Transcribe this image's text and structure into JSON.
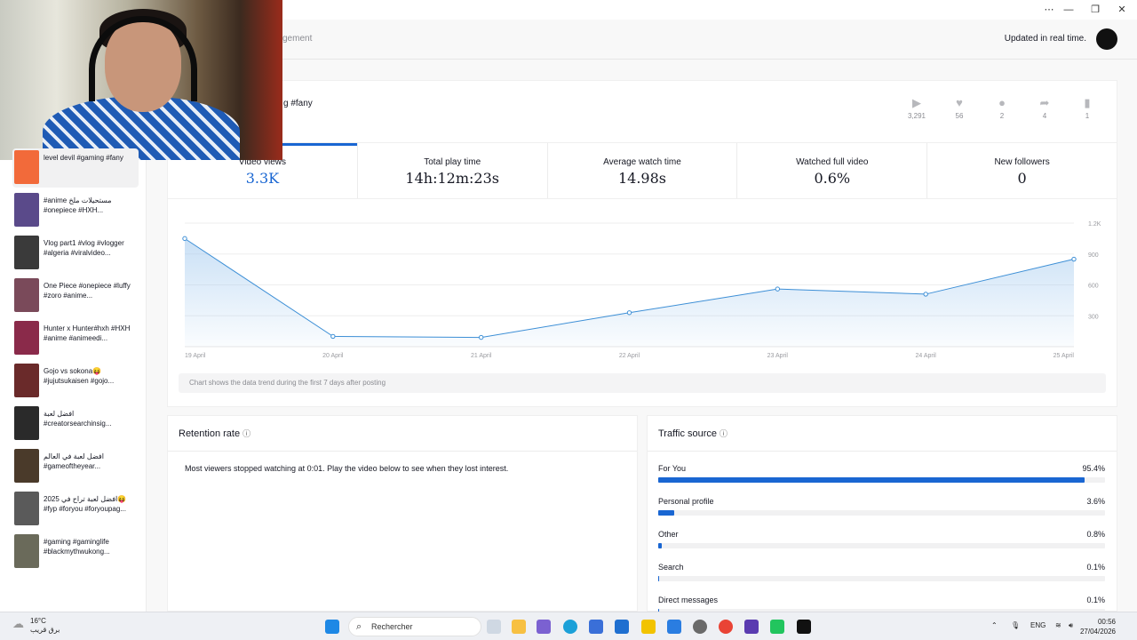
{
  "window": {
    "minimize_glyph": "—",
    "restore_glyph": "❐",
    "close_glyph": "✕",
    "inner_min_glyph": "⋯"
  },
  "header": {
    "breadcrumb_fragment": "gement",
    "updated_text": "Updated in real time."
  },
  "video": {
    "caption_fragment": "g #fany",
    "stats": [
      {
        "icon": "play-icon",
        "glyph": "▶",
        "value": "3,291"
      },
      {
        "icon": "heart-icon",
        "glyph": "♥",
        "value": "56"
      },
      {
        "icon": "comment-icon",
        "glyph": "●",
        "value": "2"
      },
      {
        "icon": "share-icon",
        "glyph": "➦",
        "value": "4"
      },
      {
        "icon": "bookmark-icon",
        "glyph": "▮",
        "value": "1"
      }
    ]
  },
  "metrics": [
    {
      "label": "Video views",
      "value": "3.3K",
      "active": true
    },
    {
      "label": "Total play time",
      "value": "14h:12m:23s",
      "active": false
    },
    {
      "label": "Average watch time",
      "value": "14.98s",
      "active": false
    },
    {
      "label": "Watched full video",
      "value": "0.6%",
      "active": false
    },
    {
      "label": "New followers",
      "value": "0",
      "active": false
    }
  ],
  "chart_data": {
    "type": "area",
    "title": "",
    "xlabel": "",
    "ylabel": "",
    "categories": [
      "19 April",
      "20 April",
      "21 April",
      "22 April",
      "23 April",
      "24 April",
      "25 April"
    ],
    "series": [
      {
        "values": [
          1050,
          100,
          90,
          330,
          560,
          510,
          850
        ]
      }
    ],
    "yticks": [
      "1.2K",
      "900",
      "600",
      "300"
    ],
    "ytick_values": [
      1200,
      900,
      600,
      300
    ],
    "ylim": [
      0,
      1200
    ],
    "grid": true,
    "color": "#3d8fd6",
    "note": "Chart shows the data trend during the first 7 days after posting"
  },
  "retention": {
    "title": "Retention rate",
    "text": "Most viewers stopped watching at 0:01. Play the video below to see when they lost interest."
  },
  "traffic": {
    "title": "Traffic source",
    "rows": [
      {
        "label": "For You",
        "pct_text": "95.4%",
        "pct": 95.4
      },
      {
        "label": "Personal profile",
        "pct_text": "3.6%",
        "pct": 3.6
      },
      {
        "label": "Other",
        "pct_text": "0.8%",
        "pct": 0.8
      },
      {
        "label": "Search",
        "pct_text": "0.1%",
        "pct": 0.1
      },
      {
        "label": "Direct messages",
        "pct_text": "0.1%",
        "pct": 0.1
      }
    ]
  },
  "sidebar": {
    "items": [
      {
        "title": "level devil #gaming #fany",
        "thumb": "#f26a3a",
        "active": true
      },
      {
        "title": "#anime مستحيلات ملخ #onepiece #HXH...",
        "thumb": "#5a4a8a",
        "active": false
      },
      {
        "title": "Vlog part1 #vlog #vlogger #algeria #viralvideo...",
        "thumb": "#3a3a3a",
        "active": false
      },
      {
        "title": "One Piece #onepiece #luffy #zoro #anime...",
        "thumb": "#7a4a5a",
        "active": false
      },
      {
        "title": "Hunter x Hunter#hxh #HXH #anime #animeedi...",
        "thumb": "#8a2a4a",
        "active": false
      },
      {
        "title": "Gojo vs sokona😝 #jujutsukaisen #gojo...",
        "thumb": "#6a2a2a",
        "active": false
      },
      {
        "title": "افضل لعبة #creatorsearchinsig...",
        "thumb": "#2a2a2a",
        "active": false
      },
      {
        "title": "افضل لعبة في العالم #gameoftheyear...",
        "thumb": "#4a3a2a",
        "active": false
      },
      {
        "title": "افضل لعبة تراح في 2025😝 #fyp #foryou #foryoupag...",
        "thumb": "#5a5a5a",
        "active": false
      },
      {
        "title": "#gaming #gaminglife #blackmythwukong...",
        "thumb": "#6a6a5a",
        "active": false
      }
    ]
  },
  "taskbar": {
    "weather_temp": "16°C",
    "weather_desc": "برق قريب",
    "search_text": "Rechercher",
    "lang": "ENG",
    "time": "00:56",
    "date": "27/04/2026"
  }
}
